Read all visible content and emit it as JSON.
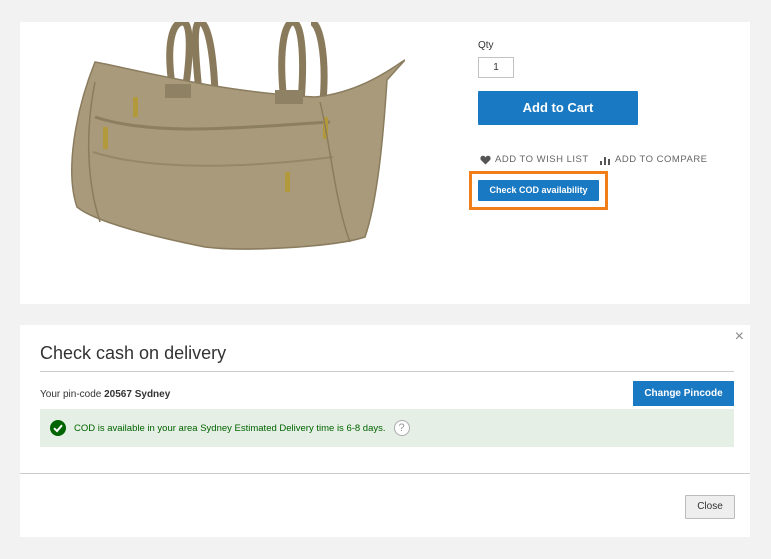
{
  "product": {
    "qty_label": "Qty",
    "qty_value": "1",
    "add_to_cart_label": "Add to Cart",
    "wishlist_label": "ADD TO WISH LIST",
    "compare_label": "ADD TO COMPARE",
    "cod_button_label": "Check COD availability",
    "image_icon": "tote-bag-image"
  },
  "modal": {
    "title": "Check cash on delivery",
    "pin_prefix": "Your pin-code",
    "pin_value": "20567 Sydney",
    "change_label": "Change Pincode",
    "success_message": "COD is available in your area Sydney Estimated Delivery time is 6-8 days.",
    "help_glyph": "?",
    "close_x": "×",
    "close_label": "Close"
  },
  "colors": {
    "primary": "#1979c3",
    "highlight": "#f07f19",
    "success_bg": "#e5efe5",
    "success_text": "#006400"
  }
}
